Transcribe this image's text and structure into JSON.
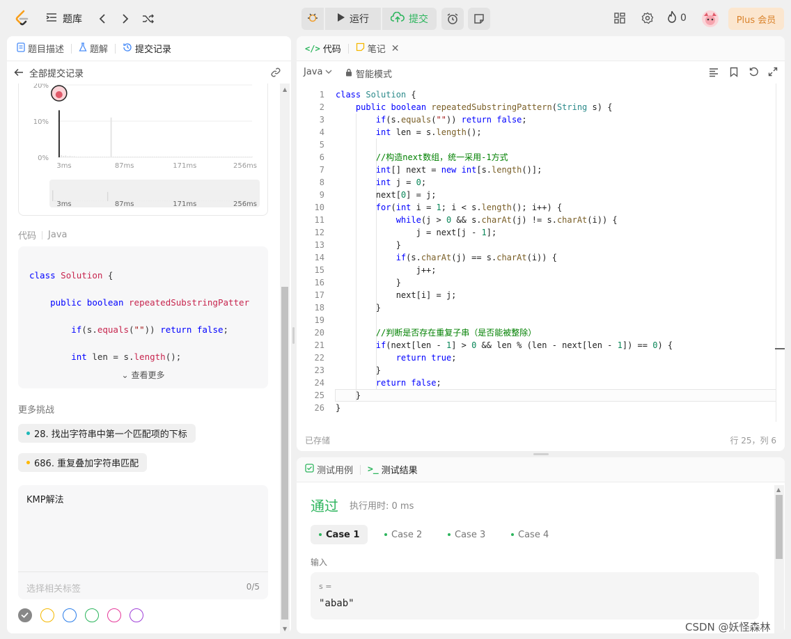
{
  "topbar": {
    "logo": "leetcode-logo",
    "problems_label": "题库",
    "run_label": "运行",
    "submit_label": "提交",
    "streak_count": "0",
    "plus_label": "Plus 会员"
  },
  "left": {
    "tabs": [
      {
        "label": "题目描述"
      },
      {
        "label": "题解"
      },
      {
        "label": "提交记录"
      }
    ],
    "back_label": "全部提交记录",
    "chart_data": {
      "type": "bar",
      "title": "",
      "ylabel": "",
      "xlabel": "",
      "y_ticks": [
        "20%",
        "10%",
        "0%"
      ],
      "x_ticks": [
        "3ms",
        "87ms",
        "171ms",
        "256ms"
      ],
      "ylim": [
        0,
        20
      ],
      "highlight_bar": {
        "x": "3ms",
        "value": 13
      },
      "values": [
        13,
        0.6,
        0.4,
        0.5,
        0.3,
        0.4,
        0.3,
        0.3,
        0.2,
        0.2,
        0.2,
        0.2,
        0.2,
        0.2,
        0.2,
        0.2,
        0.2,
        0.2,
        0.2,
        0.2,
        0.2,
        0.2,
        0.2,
        0.2,
        11,
        0.2,
        0.2,
        0.2,
        0.2,
        0.2,
        0.2,
        0.2,
        0.2,
        0.2,
        0.2,
        0.2,
        0.2,
        0.2,
        0.2,
        0.2,
        0.2,
        0.2,
        0.2,
        0.2,
        0.2,
        0.2,
        0.2,
        0.2,
        0.2,
        0.2,
        0.2,
        0.2,
        0.2,
        0.2,
        0.2,
        0.2,
        0.2,
        0.2,
        0.2,
        0.2,
        0.2,
        0.2,
        0.2,
        0.2,
        0.2,
        0.2,
        0.2,
        0.2,
        0.2,
        0.2,
        0.2,
        0.2,
        0.2,
        0.2,
        0.2,
        0.2,
        0.2,
        0.2,
        0.2,
        0.2,
        0.2,
        0.2,
        0.2,
        0.2,
        0.2,
        0.2,
        0.2,
        0.2,
        0.2,
        0.2
      ]
    },
    "code_section_label": "代码",
    "code_lang": "Java",
    "code_preview": [
      "class Solution {",
      "    public boolean repeatedSubstringPatter",
      "        if(s.equals(\"\")) return false;",
      "        int len = s.length();",
      "",
      "        //构造next数组，统一采用-1方式",
      "        int[] next = new int[s.length()];",
      "        int j = 0;"
    ],
    "show_more": "查看更多",
    "more_challenges": "更多挑战",
    "challenges": [
      {
        "label": "28. 找出字符串中第一个匹配项的下标",
        "color": "#1cb8b8"
      },
      {
        "label": "686. 重复叠加字符串匹配",
        "color": "#ffb800"
      }
    ],
    "note_text": "KMP解法",
    "tag_placeholder": "选择相关标签",
    "tag_count": "0/5"
  },
  "editor": {
    "tabs": [
      {
        "label": "代码"
      },
      {
        "label": "笔记"
      }
    ],
    "language": "Java",
    "mode": "智能模式",
    "saved_label": "已存储",
    "cursor_pos": "行 25，列 6",
    "lines": [
      "class Solution {",
      "    public boolean repeatedSubstringPattern(String s) {",
      "        if(s.equals(\"\")) return false;",
      "        int len = s.length();",
      "",
      "        //构造next数组，统一采用-1方式",
      "        int[] next = new int[s.length()];",
      "        int j = 0;",
      "        next[0] = j;",
      "        for(int i = 1; i < s.length(); i++) {",
      "            while(j > 0 && s.charAt(j) != s.charAt(i)) {",
      "                j = next[j - 1];",
      "            }",
      "            if(s.charAt(j) == s.charAt(i)) {",
      "                j++;",
      "            }",
      "            next[i] = j;",
      "        }",
      "",
      "        //判断是否存在重复子串（是否能被整除）",
      "        if(next[len - 1] > 0 && len % (len - next[len - 1]) == 0) {",
      "            return true;",
      "        }",
      "        return false;",
      "    }",
      "}"
    ]
  },
  "result": {
    "tabs": [
      {
        "label": "测试用例"
      },
      {
        "label": "测试结果"
      }
    ],
    "status": "通过",
    "runtime": "执行用时: 0 ms",
    "cases": [
      "Case 1",
      "Case 2",
      "Case 3",
      "Case 4"
    ],
    "input_label": "输入",
    "var_label": "s =",
    "var_value": "\"abab\"",
    "watermark": "CSDN @妖怪森林"
  },
  "colors": {
    "accent_green": "#2db55d",
    "plus_bg": "#fbe6cf",
    "plus_text": "#d9822b"
  }
}
